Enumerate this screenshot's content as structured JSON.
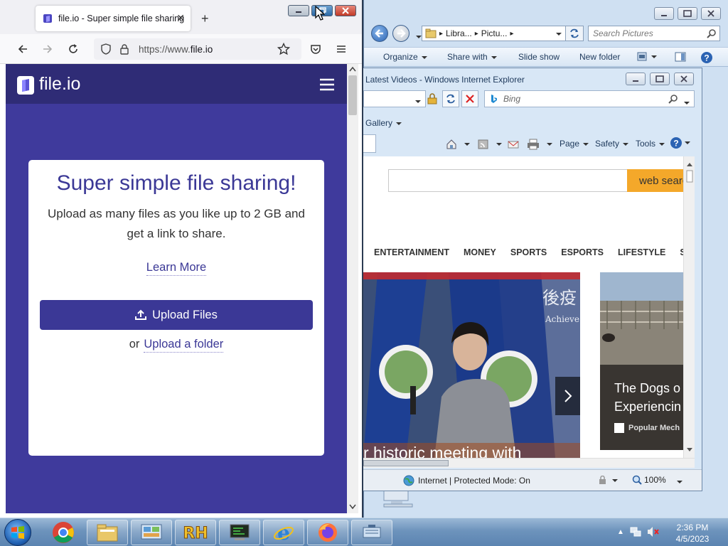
{
  "explorer": {
    "breadcrumb": [
      "Libra...",
      "Pictu..."
    ],
    "search_placeholder": "Search Pictures",
    "toolbar": {
      "organize": "Organize",
      "share_with": "Share with",
      "slide_show": "Slide show",
      "new_folder": "New folder"
    }
  },
  "ie": {
    "title": "Latest Videos - Windows Internet Explorer",
    "search_placeholder": "Bing",
    "favorites_item": "Gallery",
    "commands": {
      "page": "Page",
      "safety": "Safety",
      "tools": "Tools"
    },
    "msn": {
      "search_button": "web search",
      "categories": [
        "ENTERTAINMENT",
        "MONEY",
        "SPORTS",
        "ESPORTS",
        "LIFESTYLE",
        "SH"
      ],
      "story1_caption": "r historic meeting with",
      "story1_sign_chars": "後疫",
      "story1_sign_word": "Achieve",
      "story2_title": "The Dogs o Experiencin",
      "story2_source": "Popular Mech"
    },
    "status": {
      "zone": "Internet | Protected Mode: On",
      "zoom": "100%"
    }
  },
  "firefox": {
    "tab_title": "file.io - Super simple file sharing",
    "url_prefix": "https://www.",
    "url_domain": "file.io",
    "site": {
      "logo": "file.io",
      "title": "Super simple file sharing!",
      "subtitle": "Upload as many files as you like up to 2 GB and get a link to share.",
      "learn_more": "Learn More",
      "upload_button": "Upload Files",
      "or": "or",
      "upload_folder": "Upload a folder"
    }
  },
  "taskbar": {
    "time": "2:36 PM",
    "date": "4/5/2023",
    "apps": [
      "start-orb",
      "chrome",
      "file-explorer",
      "control-panel",
      "rh-app",
      "terminal",
      "internet-explorer",
      "firefox",
      "network-app"
    ]
  },
  "colors": {
    "brand": "#3b3896",
    "brand_dark": "#2f2c76",
    "msn_search": "#f4a82a"
  }
}
